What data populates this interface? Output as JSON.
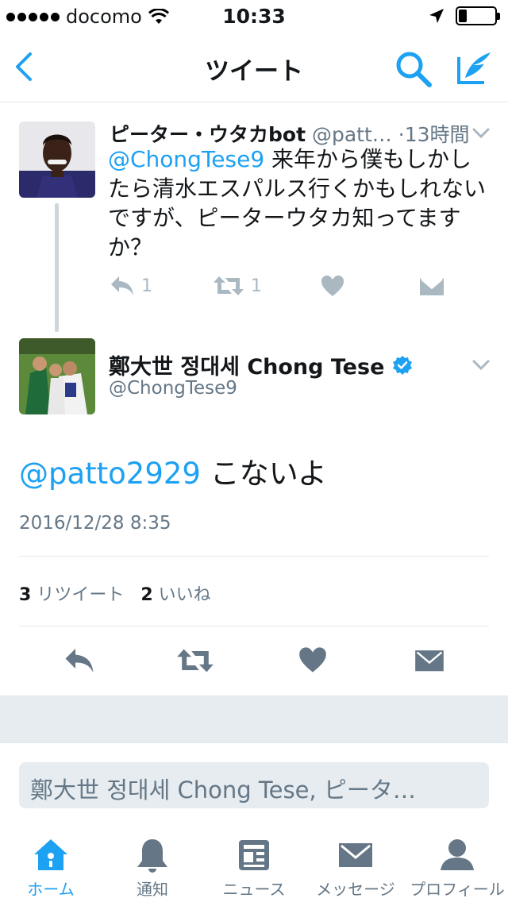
{
  "status_bar": {
    "carrier": "docomo",
    "time": "10:33",
    "battery_level": 0.2
  },
  "nav": {
    "title": "ツイート",
    "accent": "#1da1f2"
  },
  "parent_tweet": {
    "name": "ピーター・ウタカbot",
    "handle": "@patt…",
    "time": "13時間",
    "mention": "@ChongTese9",
    "text": " 来年から僕もしかしたら清水エスパルス行くかもしれないですが、ピーターウタカ知ってますか？",
    "reply_count": "1",
    "retweet_count": "1"
  },
  "main_tweet": {
    "name": "鄭大世 정대세 Chong Tese",
    "handle": "@ChongTese9",
    "mention": "@patto2929",
    "text": " こないよ",
    "date": "2016/12/28 8:35",
    "retweets_count": "3",
    "retweets_label": "リツイート",
    "likes_count": "2",
    "likes_label": "いいね"
  },
  "reply_box": {
    "placeholder": "鄭大世 정대세 Chong Tese, ピータ…"
  },
  "tabs": [
    {
      "label": "ホーム",
      "icon": "home-icon",
      "active": true
    },
    {
      "label": "通知",
      "icon": "bell-icon",
      "active": false
    },
    {
      "label": "ニュース",
      "icon": "news-icon",
      "active": false
    },
    {
      "label": "メッセージ",
      "icon": "envelope-icon",
      "active": false
    },
    {
      "label": "プロフィール",
      "icon": "person-icon",
      "active": false
    }
  ]
}
